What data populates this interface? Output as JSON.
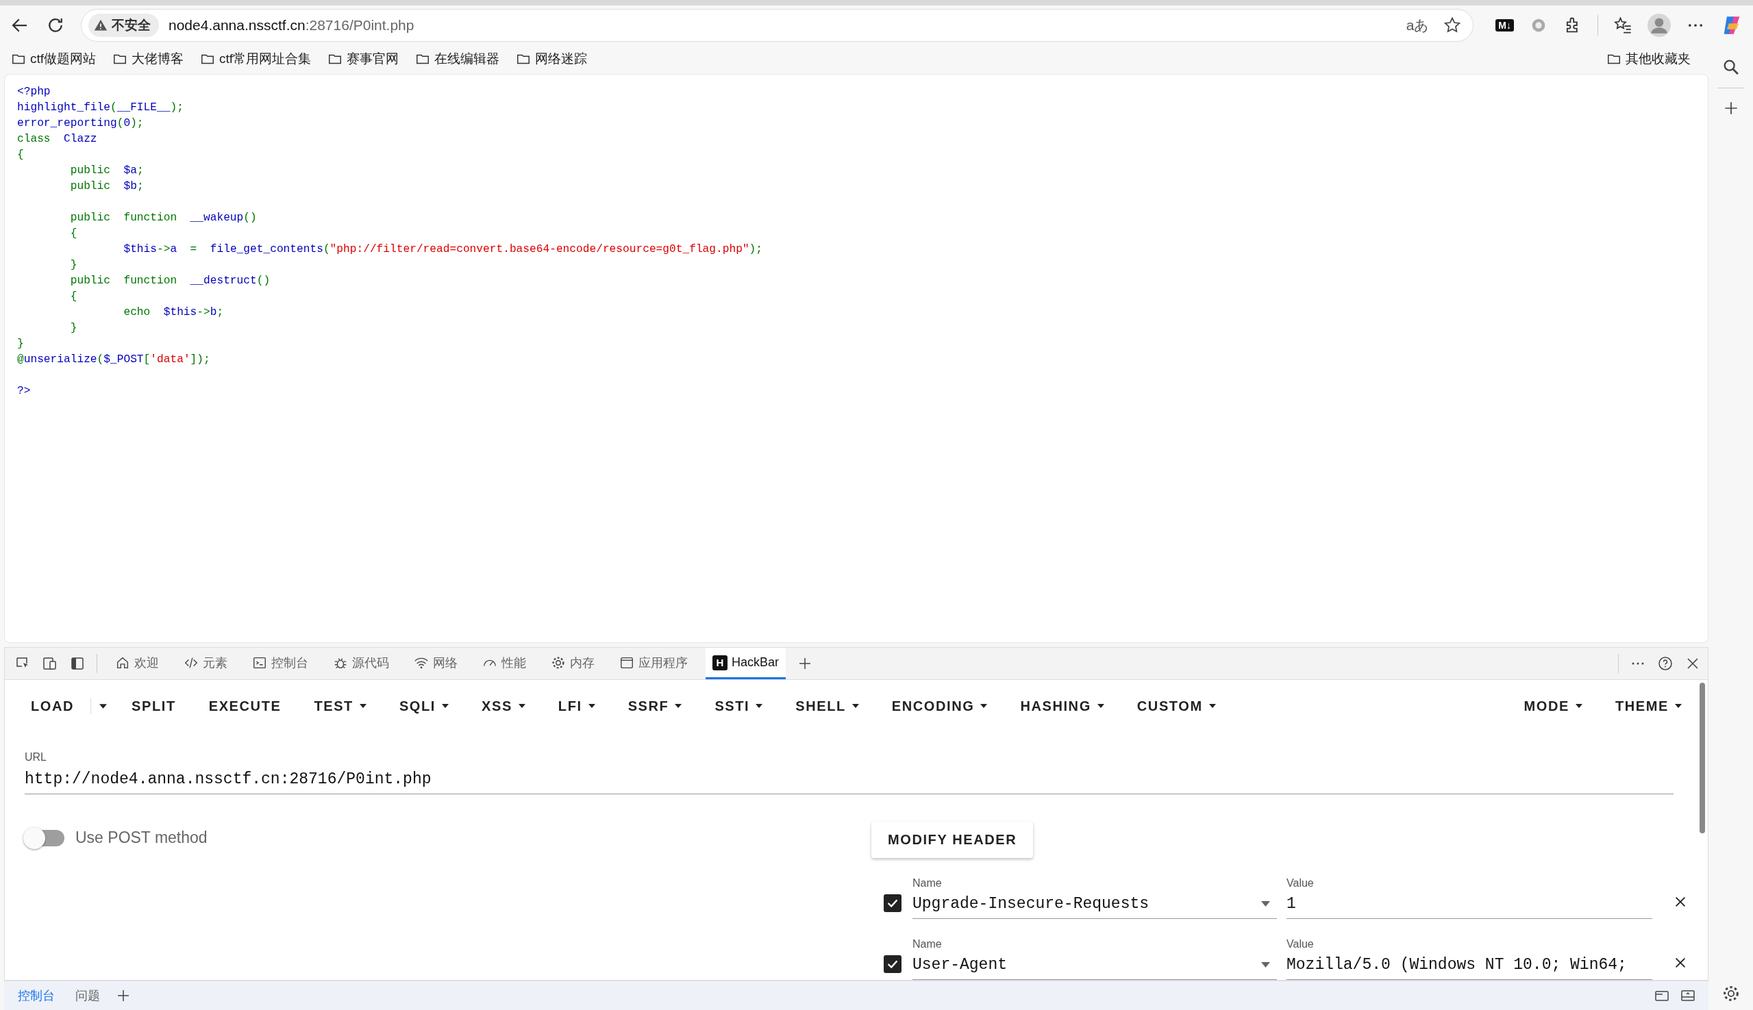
{
  "address_bar": {
    "security_label": "不安全",
    "host": "node4.anna.nssctf.cn",
    "path": ":28716/P0int.php",
    "read_aloud": "aあ"
  },
  "extension_badge": "M↓",
  "bookmarks": [
    "ctf做题网站",
    "大佬博客",
    "ctf常用网址合集",
    "赛事官网",
    "在线编辑器",
    "网络迷踪"
  ],
  "other_bookmarks": "其他收藏夹",
  "code_lines": [
    {
      "kind": "code",
      "tokens": [
        {
          "text": "<?php",
          "kind": "default"
        }
      ]
    },
    {
      "kind": "code",
      "tokens": [
        {
          "text": "highlight_file",
          "kind": "default"
        },
        {
          "text": "(",
          "kind": "keyword"
        },
        {
          "text": "__FILE__",
          "kind": "default"
        },
        {
          "text": ");",
          "kind": "keyword"
        }
      ]
    },
    {
      "kind": "code",
      "tokens": [
        {
          "text": "error_reporting",
          "kind": "default"
        },
        {
          "text": "(",
          "kind": "keyword"
        },
        {
          "text": "0",
          "kind": "default"
        },
        {
          "text": ");",
          "kind": "keyword"
        }
      ]
    },
    {
      "kind": "code",
      "tokens": [
        {
          "text": "class  ",
          "kind": "keyword"
        },
        {
          "text": "Clazz",
          "kind": "default"
        }
      ]
    },
    {
      "kind": "code",
      "tokens": [
        {
          "text": "{",
          "kind": "keyword"
        }
      ]
    },
    {
      "kind": "code",
      "tokens": [
        {
          "text": "        public  ",
          "kind": "keyword"
        },
        {
          "text": "$a",
          "kind": "default"
        },
        {
          "text": ";",
          "kind": "keyword"
        }
      ]
    },
    {
      "kind": "code",
      "tokens": [
        {
          "text": "        public  ",
          "kind": "keyword"
        },
        {
          "text": "$b",
          "kind": "default"
        },
        {
          "text": ";",
          "kind": "keyword"
        }
      ]
    },
    {
      "kind": "blank"
    },
    {
      "kind": "code",
      "tokens": [
        {
          "text": "        public  function  ",
          "kind": "keyword"
        },
        {
          "text": "__wakeup",
          "kind": "default"
        },
        {
          "text": "()",
          "kind": "keyword"
        }
      ]
    },
    {
      "kind": "code",
      "tokens": [
        {
          "text": "        {",
          "kind": "keyword"
        }
      ]
    },
    {
      "kind": "code",
      "tokens": [
        {
          "text": "                $this",
          "kind": "default"
        },
        {
          "text": "->",
          "kind": "keyword"
        },
        {
          "text": "a  ",
          "kind": "default"
        },
        {
          "text": "=  ",
          "kind": "keyword"
        },
        {
          "text": "file_get_contents",
          "kind": "default"
        },
        {
          "text": "(",
          "kind": "keyword"
        },
        {
          "text": "\"php://filter/read=convert.base64-encode/resource=g0t_flag.php\"",
          "kind": "string"
        },
        {
          "text": ");",
          "kind": "keyword"
        }
      ]
    },
    {
      "kind": "code",
      "tokens": [
        {
          "text": "        }",
          "kind": "keyword"
        }
      ]
    },
    {
      "kind": "code",
      "tokens": [
        {
          "text": "        public  function  ",
          "kind": "keyword"
        },
        {
          "text": "__destruct",
          "kind": "default"
        },
        {
          "text": "()",
          "kind": "keyword"
        }
      ]
    },
    {
      "kind": "code",
      "tokens": [
        {
          "text": "        {",
          "kind": "keyword"
        }
      ]
    },
    {
      "kind": "code",
      "tokens": [
        {
          "text": "                echo  ",
          "kind": "keyword"
        },
        {
          "text": "$this",
          "kind": "default"
        },
        {
          "text": "->",
          "kind": "keyword"
        },
        {
          "text": "b",
          "kind": "default"
        },
        {
          "text": ";",
          "kind": "keyword"
        }
      ]
    },
    {
      "kind": "code",
      "tokens": [
        {
          "text": "        }",
          "kind": "keyword"
        }
      ]
    },
    {
      "kind": "code",
      "tokens": [
        {
          "text": "}",
          "kind": "keyword"
        }
      ]
    },
    {
      "kind": "code",
      "tokens": [
        {
          "text": "@",
          "kind": "keyword"
        },
        {
          "text": "unserialize",
          "kind": "default"
        },
        {
          "text": "(",
          "kind": "keyword"
        },
        {
          "text": "$_POST",
          "kind": "default"
        },
        {
          "text": "[",
          "kind": "keyword"
        },
        {
          "text": "'data'",
          "kind": "string"
        },
        {
          "text": "]);",
          "kind": "keyword"
        }
      ]
    },
    {
      "kind": "blank"
    },
    {
      "kind": "code",
      "tokens": [
        {
          "text": "?>",
          "kind": "default"
        }
      ]
    }
  ],
  "devtools": {
    "tabs": [
      {
        "label": "欢迎",
        "selected": false
      },
      {
        "label": "元素",
        "selected": false
      },
      {
        "label": "控制台",
        "selected": false
      },
      {
        "label": "源代码",
        "selected": false
      },
      {
        "label": "网络",
        "selected": false
      },
      {
        "label": "性能",
        "selected": false
      },
      {
        "label": "内存",
        "selected": false
      },
      {
        "label": "应用程序",
        "selected": false
      },
      {
        "label": "HackBar",
        "selected": true,
        "logo_letter": "H"
      }
    ],
    "drawer_tabs": [
      {
        "label": "控制台",
        "selected": true
      },
      {
        "label": "问题",
        "selected": false
      }
    ]
  },
  "hackbar": {
    "toolbar": [
      {
        "label": "LOAD",
        "kind": "split"
      },
      {
        "label": "SPLIT",
        "kind": "plain"
      },
      {
        "label": "EXECUTE",
        "kind": "plain"
      },
      {
        "label": "TEST",
        "kind": "menu"
      },
      {
        "label": "SQLI",
        "kind": "menu"
      },
      {
        "label": "XSS",
        "kind": "menu"
      },
      {
        "label": "LFI",
        "kind": "menu"
      },
      {
        "label": "SSRF",
        "kind": "menu"
      },
      {
        "label": "SSTI",
        "kind": "menu"
      },
      {
        "label": "SHELL",
        "kind": "menu"
      },
      {
        "label": "ENCODING",
        "kind": "menu"
      },
      {
        "label": "HASHING",
        "kind": "menu"
      },
      {
        "label": "CUSTOM",
        "kind": "menu"
      }
    ],
    "right_menus": [
      {
        "label": "MODE",
        "kind": "menu"
      },
      {
        "label": "THEME",
        "kind": "menu"
      }
    ],
    "url": {
      "label": "URL",
      "value": "http://node4.anna.nssctf.cn:28716/P0int.php"
    },
    "post_toggle": {
      "label": "Use POST method",
      "on": false
    },
    "modify_header": "MODIFY HEADER",
    "headers": [
      {
        "checked": true,
        "name_label": "Name",
        "name": "Upgrade-Insecure-Requests",
        "value_label": "Value",
        "value": "1"
      },
      {
        "checked": true,
        "name_label": "Name",
        "name": "User-Agent",
        "value_label": "Value",
        "value": "Mozilla/5.0 (Windows NT 10.0; Win64;"
      }
    ]
  }
}
